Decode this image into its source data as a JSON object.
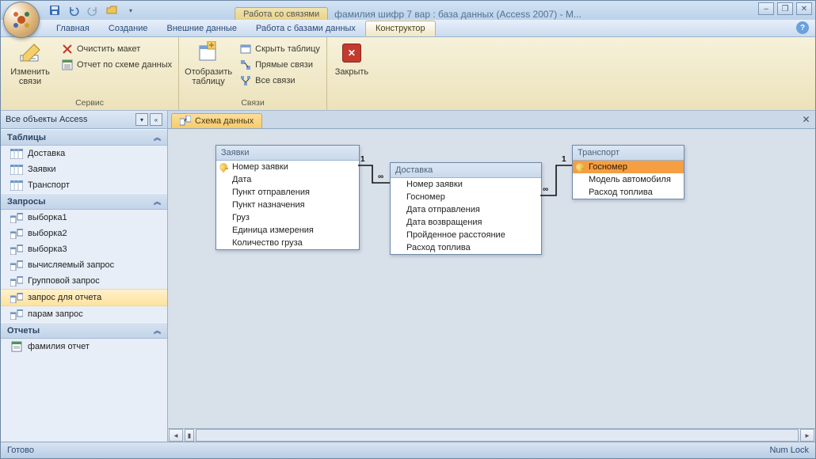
{
  "title": {
    "context_tab": "Работа со связями",
    "text": "фамилия шифр 7 вар : база данных (Access 2007) - M..."
  },
  "tabs": {
    "t0": "Главная",
    "t1": "Создание",
    "t2": "Внешние данные",
    "t3": "Работа с базами данных",
    "t4": "Конструктор"
  },
  "ribbon": {
    "g1": {
      "edit_rel": "Изменить связи",
      "clear_layout": "Очистить макет",
      "rel_report": "Отчет по схеме данных",
      "label": "Сервис"
    },
    "g2": {
      "show_table": "Отобразить таблицу",
      "hide_table": "Скрыть таблицу",
      "direct_rel": "Прямые связи",
      "all_rel": "Все связи",
      "label": "Связи"
    },
    "g3": {
      "close": "Закрыть"
    }
  },
  "nav": {
    "header": "Все объекты Access",
    "sec_tables": "Таблицы",
    "tables": [
      "Доставка",
      "Заявки",
      "Транспорт"
    ],
    "sec_queries": "Запросы",
    "queries": [
      "выборка1",
      "выборка2",
      "выборка3",
      "вычисляемый запрос",
      "Групповой запрос",
      "запрос для отчета",
      "парам запрос"
    ],
    "sec_reports": "Отчеты",
    "reports": [
      "фамилия отчет"
    ],
    "selected_query": "запрос для отчета"
  },
  "doc_tab": "Схема данных",
  "diagram": {
    "t1": {
      "title": "Заявки",
      "f0": "Номер заявки",
      "f1": "Дата",
      "f2": "Пункт отправления",
      "f3": "Пункт назначения",
      "f4": "Груз",
      "f5": "Единица измерения",
      "f6": "Количество груза"
    },
    "t2": {
      "title": "Доставка",
      "f0": "Номер заявки",
      "f1": "Госномер",
      "f2": "Дата отправления",
      "f3": "Дата возвращения",
      "f4": "Пройденное расстояние",
      "f5": "Расход топлива"
    },
    "t3": {
      "title": "Транспорт",
      "f0": "Госномер",
      "f1": "Модель автомобиля",
      "f2": "Расход топлива"
    },
    "one": "1",
    "many": "∞"
  },
  "status": {
    "ready": "Готово",
    "numlock": "Num Lock"
  }
}
